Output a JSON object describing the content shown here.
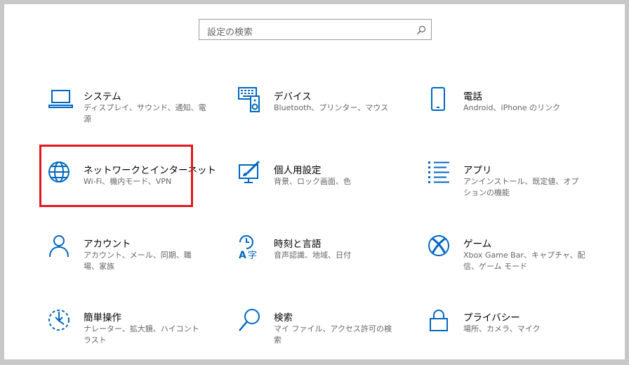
{
  "search": {
    "placeholder": "設定の検索"
  },
  "accent_color": "#0067c0",
  "highlight_color": "#e0191f",
  "tiles": [
    {
      "title": "システム",
      "desc": "ディスプレイ、サウンド、通知、電源",
      "icon": "laptop-icon"
    },
    {
      "title": "デバイス",
      "desc": "Bluetooth、プリンター、マウス",
      "icon": "keyboard-speaker-icon"
    },
    {
      "title": "電話",
      "desc": "Android、iPhone のリンク",
      "icon": "phone-icon"
    },
    {
      "title": "ネットワークとインターネット",
      "desc": "Wi-Fi、機内モード、VPN",
      "icon": "globe-icon"
    },
    {
      "title": "個人用設定",
      "desc": "背景、ロック画面、色",
      "icon": "paintbrush-monitor-icon"
    },
    {
      "title": "アプリ",
      "desc": "アンインストール、既定値、オプションの機能",
      "icon": "apps-list-icon"
    },
    {
      "title": "アカウント",
      "desc": "アカウント、メール、同期、職場、家族",
      "icon": "person-icon"
    },
    {
      "title": "時刻と言語",
      "desc": "音声認識、地域、日付",
      "icon": "time-language-icon"
    },
    {
      "title": "ゲーム",
      "desc": "Xbox Game Bar、キャプチャ、配信、ゲーム モード",
      "icon": "xbox-icon"
    },
    {
      "title": "簡単操作",
      "desc": "ナレーター、拡大鏡、ハイコントラスト",
      "icon": "ease-of-access-icon"
    },
    {
      "title": "検索",
      "desc": "マイ ファイル、アクセス許可の検索",
      "icon": "magnifier-icon"
    },
    {
      "title": "プライバシー",
      "desc": "場所、カメラ、マイク",
      "icon": "lock-icon"
    }
  ]
}
